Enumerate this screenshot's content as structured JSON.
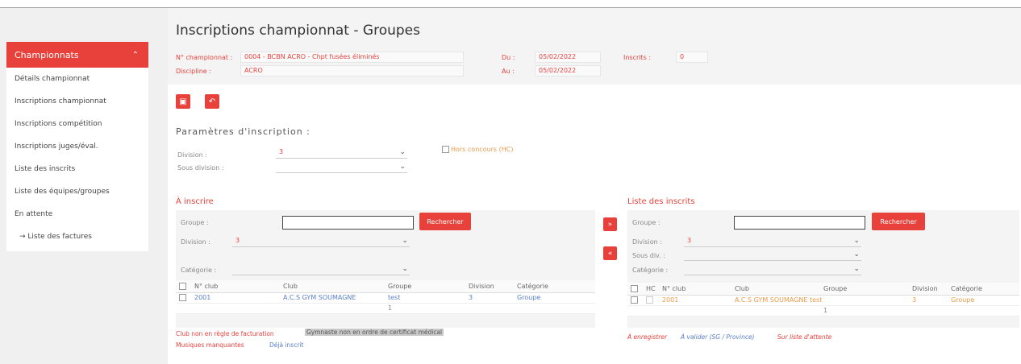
{
  "sidebar": {
    "header": "Championnats",
    "items": [
      "Détails championnat",
      "Inscriptions championnat",
      "Inscriptions compétition",
      "Inscriptions juges/éval.",
      "Liste des inscrits",
      "Liste des équipes/groupes",
      "En attente",
      "→ Liste des factures"
    ]
  },
  "header": {
    "title": "Inscriptions championnat - Groupes",
    "champ_label": "N° championnat :",
    "champ_value": "0004 - BCBN ACRO - Chpt fusées éliminés",
    "discipline_label": "Discipline :",
    "discipline_value": "ACRO",
    "du_label": "Du :",
    "du_value": "05/02/2022",
    "au_label": "Au :",
    "au_value": "05/02/2022",
    "inscrits_label": "Inscrits :",
    "inscrits_value": "0"
  },
  "params": {
    "title": "Paramètres d'inscription :",
    "division_label": "Division :",
    "division_value": "3",
    "sousdiv_label": "Sous division :",
    "sousdiv_value": "",
    "hors_label": "Hors concours (HC)"
  },
  "left": {
    "title": "À inscrire",
    "groupe_label": "Groupe :",
    "search_button": "Rechercher",
    "division_label": "Division :",
    "division_value": "3",
    "categorie_label": "Catégorie :",
    "columns": [
      "N° club",
      "Club",
      "Groupe",
      "Division",
      "Catégorie"
    ],
    "rows": [
      [
        "2001",
        "A.C.S GYM SOUMAGNE",
        "test",
        "3",
        "Groupe"
      ]
    ],
    "footer": "1",
    "legend": {
      "a": "Club non en règle de facturation",
      "b": "Gymnaste non en ordre de certificat médical",
      "c": "Musiques manquantes",
      "d": "Déjà inscrit"
    }
  },
  "move": {
    "add": "»",
    "remove": "«"
  },
  "right": {
    "title": "Liste des inscrits",
    "groupe_label": "Groupe :",
    "search_button": "Rechercher",
    "division_label": "Division :",
    "division_value": "3",
    "sousdiv_label": "Sous div. :",
    "categorie_label": "Catégorie :",
    "columns": [
      "HC",
      "N° club",
      "Club",
      "Groupe",
      "Division",
      "Catégorie"
    ],
    "rows": [
      [
        "2001",
        "A.C.S GYM SOUMAGNE test",
        "3",
        "Groupe"
      ]
    ],
    "footer": "1",
    "legend": {
      "a": "À enregistrer",
      "b": "À valider (SG / Province)",
      "c": "Sur liste d'attente"
    }
  },
  "colors": {
    "accent": "#e8413b",
    "link": "#5b7fc9"
  }
}
